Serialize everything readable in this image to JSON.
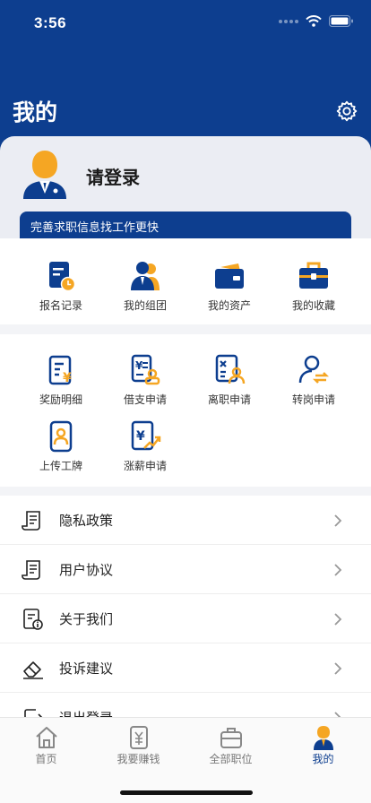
{
  "status": {
    "time": "3:56"
  },
  "header": {
    "title": "我的"
  },
  "profile": {
    "login_prompt": "请登录",
    "banner_text": "完善求职信息找工作更快"
  },
  "quick_actions": [
    {
      "label": "报名记录",
      "icon": "registration-record-icon"
    },
    {
      "label": "我的组团",
      "icon": "my-group-icon"
    },
    {
      "label": "我的资产",
      "icon": "wallet-icon"
    },
    {
      "label": "我的收藏",
      "icon": "briefcase-favorite-icon"
    }
  ],
  "services": [
    {
      "label": "奖励明细",
      "icon": "reward-detail-icon"
    },
    {
      "label": "借支申请",
      "icon": "advance-payment-icon"
    },
    {
      "label": "离职申请",
      "icon": "resignation-icon"
    },
    {
      "label": "转岗申请",
      "icon": "transfer-icon"
    },
    {
      "label": "上传工牌",
      "icon": "badge-upload-icon"
    },
    {
      "label": "涨薪申请",
      "icon": "raise-request-icon"
    }
  ],
  "menu": [
    {
      "label": "隐私政策",
      "icon": "document-icon"
    },
    {
      "label": "用户协议",
      "icon": "document-icon"
    },
    {
      "label": "关于我们",
      "icon": "info-doc-icon"
    },
    {
      "label": "投诉建议",
      "icon": "eraser-icon"
    },
    {
      "label": "退出登录",
      "icon": "logout-icon"
    }
  ],
  "tabs": [
    {
      "label": "首页",
      "icon": "home-icon"
    },
    {
      "label": "我要赚钱",
      "icon": "money-icon"
    },
    {
      "label": "全部职位",
      "icon": "jobs-briefcase-icon"
    },
    {
      "label": "我的",
      "icon": "profile-icon",
      "active": true
    }
  ],
  "colors": {
    "primary": "#0d3e8f",
    "accent": "#f5a623"
  }
}
